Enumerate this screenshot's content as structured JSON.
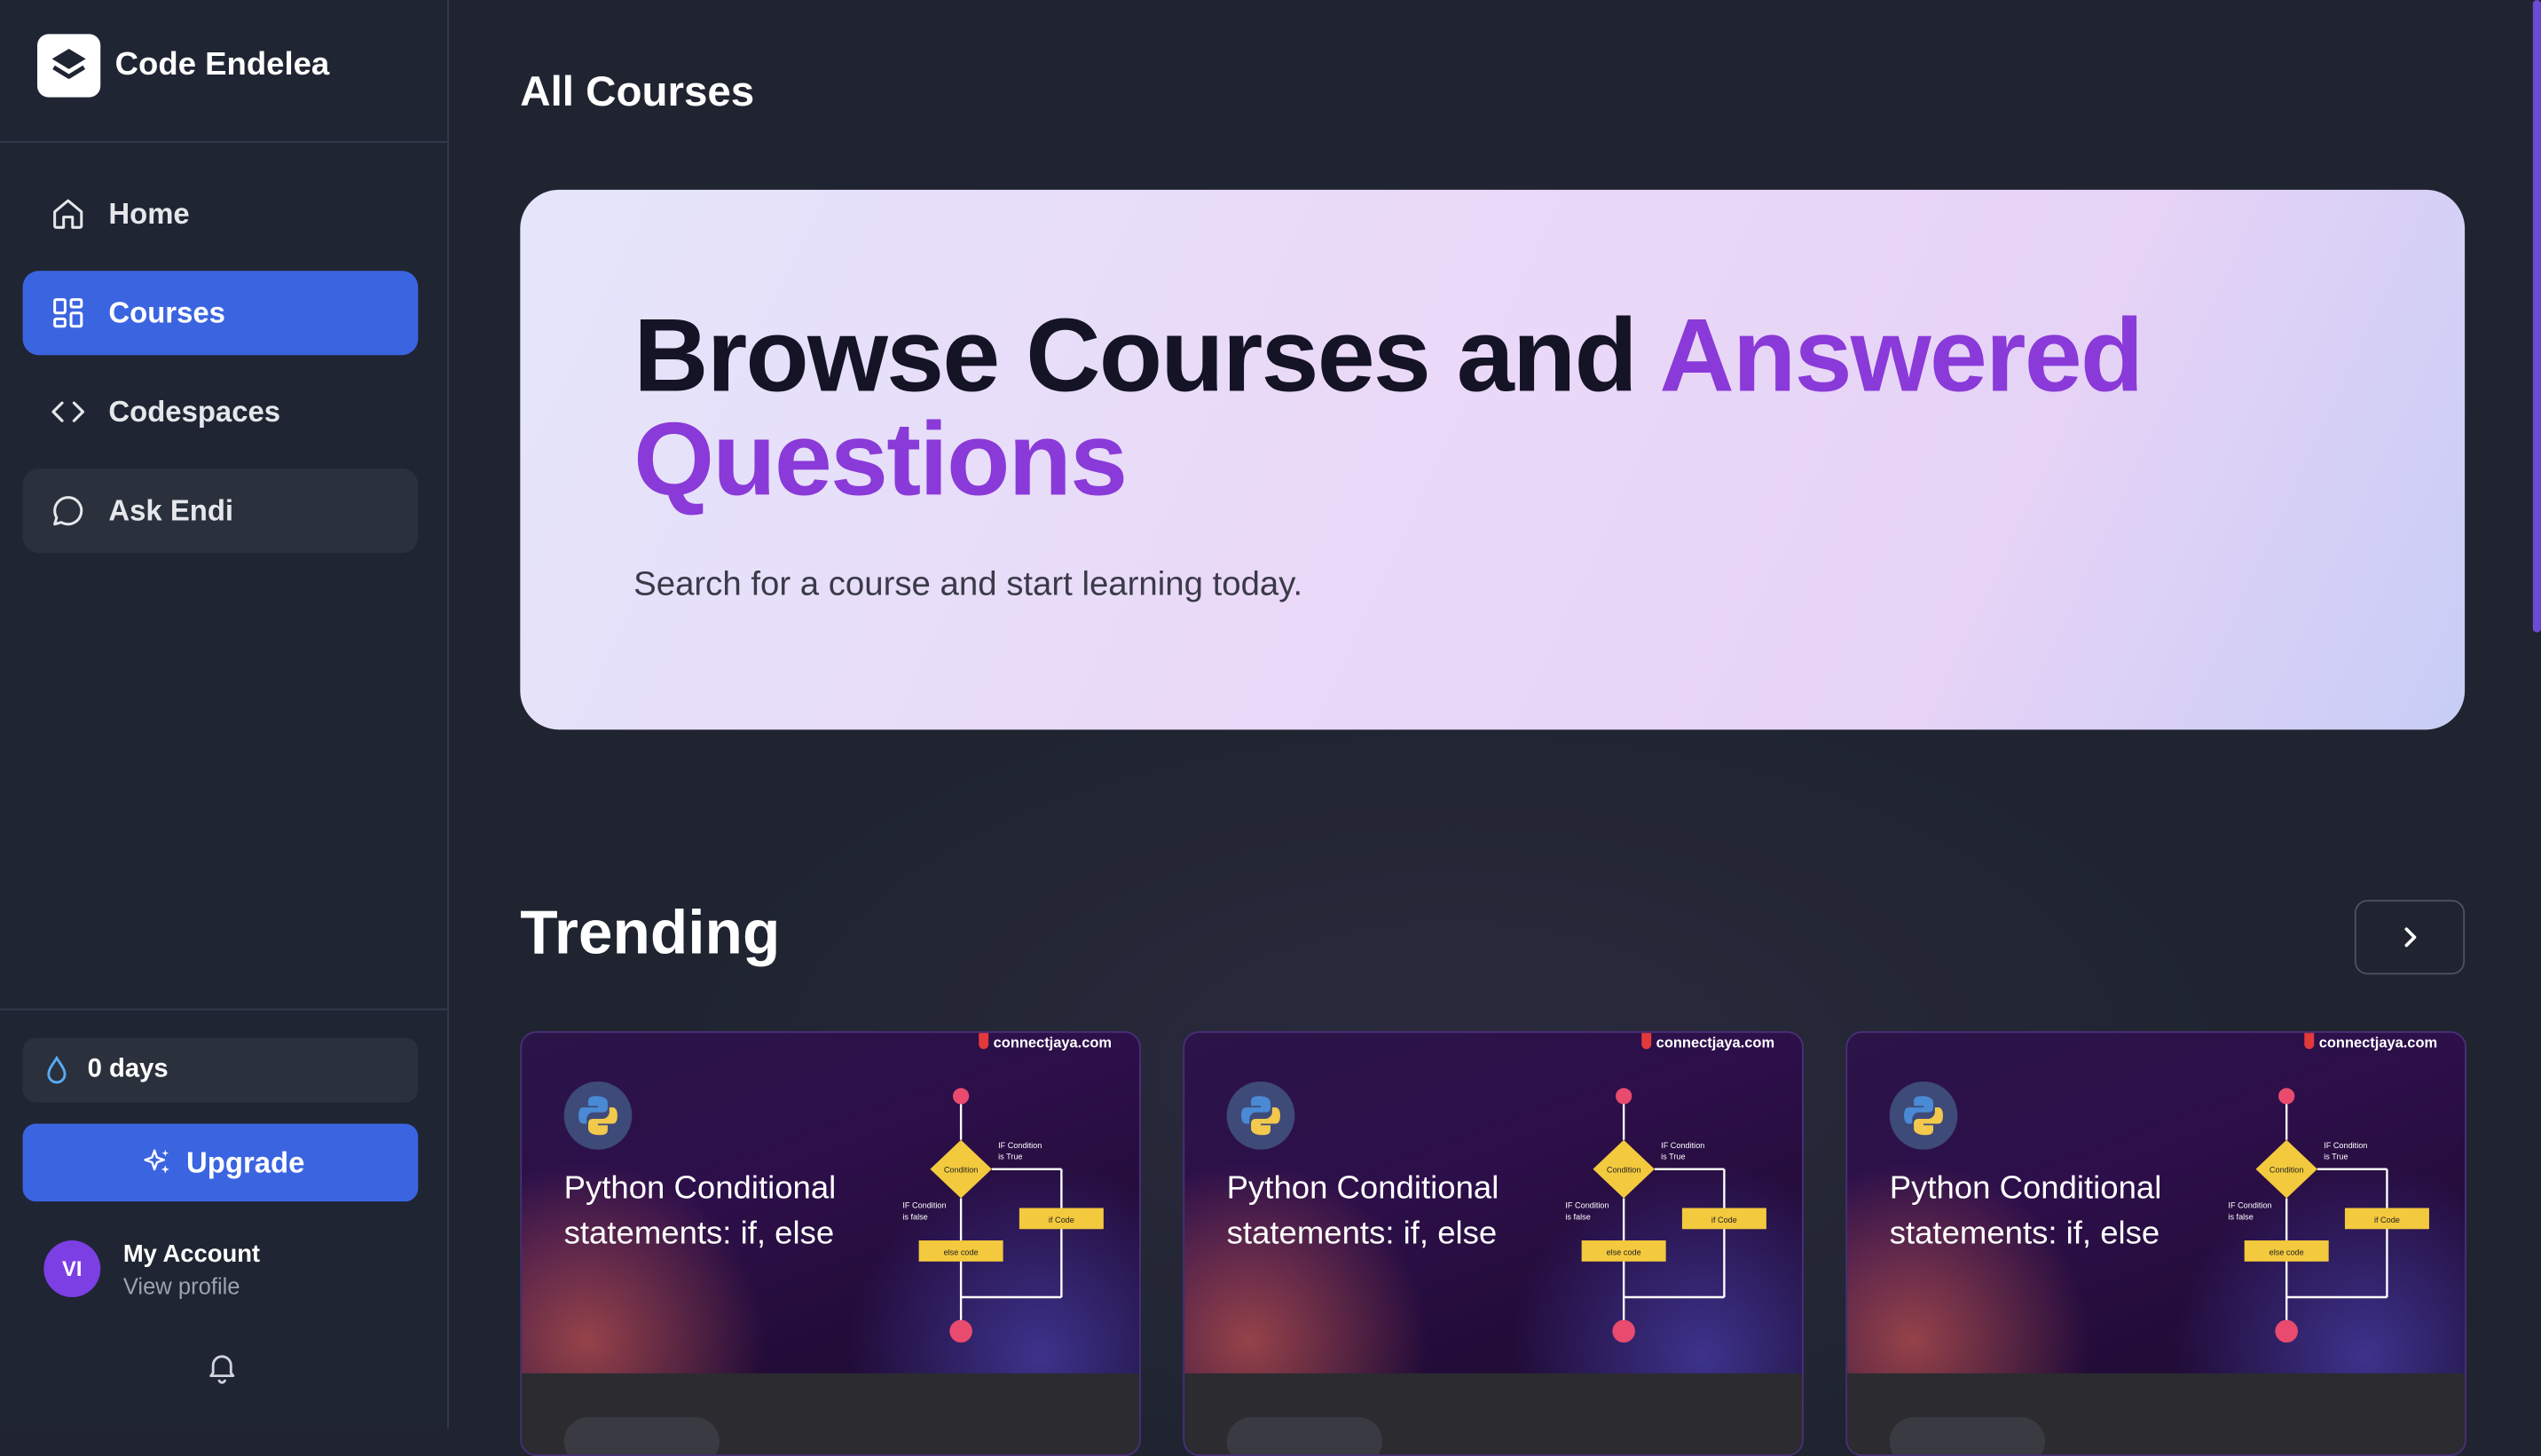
{
  "app": {
    "name": "Code Endelea"
  },
  "sidebar": {
    "items": [
      {
        "label": "Home",
        "icon": "home-icon"
      },
      {
        "label": "Courses",
        "icon": "grid-icon",
        "active": true
      },
      {
        "label": "Codespaces",
        "icon": "code-icon"
      },
      {
        "label": "Ask Endi",
        "icon": "chat-bubble-icon"
      }
    ],
    "streak": {
      "label": "0 days",
      "icon": "droplet-icon"
    },
    "upgrade_label": "Upgrade",
    "account": {
      "initials": "VI",
      "name": "My Account",
      "sub": "View profile"
    }
  },
  "main": {
    "page_title": "All Courses",
    "hero": {
      "title_part1": "Browse Courses and ",
      "title_accent": "Answered Questions",
      "subtitle": "Search for a course and start learning today."
    },
    "trending_title": "Trending",
    "cards": [
      {
        "title": "Python Conditional statements: if, else",
        "watermark": "connectjaya.com"
      },
      {
        "title": "Python Conditional statements: if, else",
        "watermark": "connectjaya.com"
      },
      {
        "title": "Python Conditional statements: if, else",
        "watermark": "connectjaya.com"
      }
    ],
    "flowchart": {
      "condition": "Condition",
      "true_label": "IF Condition is True",
      "false_label": "IF Condition is false",
      "if_code": "if Code",
      "else_code": "else code"
    }
  },
  "colors": {
    "accent": "#3b64e0",
    "purple": "#8a3ad8",
    "background": "#1f2430"
  }
}
